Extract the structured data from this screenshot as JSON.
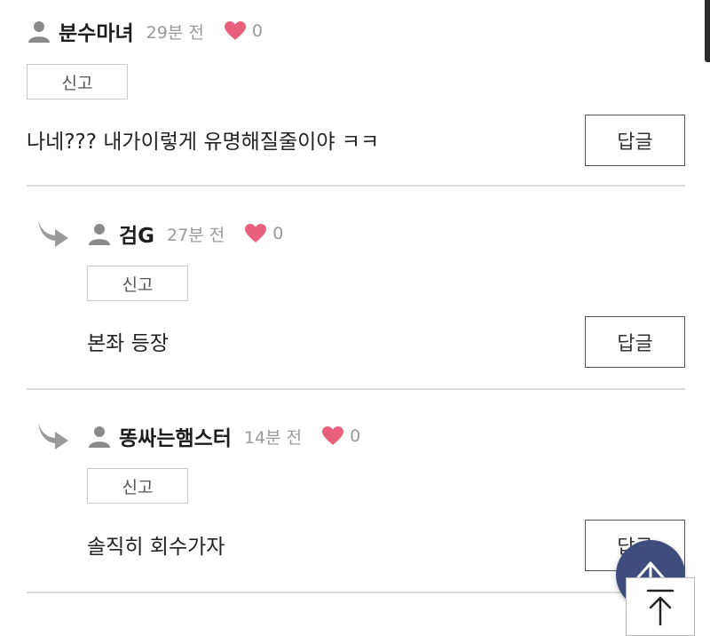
{
  "comments": [
    {
      "author": "분수마녀",
      "time": "29분 전",
      "likes": "0",
      "report_label": "신고",
      "text": "나네??? 내가이렇게 유명해질줄이야 ㅋㅋ",
      "reply_label": "답글",
      "is_reply": false
    },
    {
      "author": "검G",
      "time": "27분 전",
      "likes": "0",
      "report_label": "신고",
      "text": "본좌 등장",
      "reply_label": "답글",
      "is_reply": true
    },
    {
      "author": "똥싸는햄스터",
      "time": "14분 전",
      "likes": "0",
      "report_label": "신고",
      "text": "솔직히 회수가자",
      "reply_label": "답글",
      "is_reply": true
    }
  ],
  "icons": {
    "person": "person-icon",
    "like": "heart-icon",
    "reply_indicator": "reply-arrow-icon",
    "scroll_up": "arrow-up-icon",
    "to_top": "arrow-to-top-icon"
  },
  "colors": {
    "heart": "#e8607d",
    "fab": "#3f4d7d",
    "muted_text": "#9a9a9a",
    "divider": "#dcdcdc"
  }
}
